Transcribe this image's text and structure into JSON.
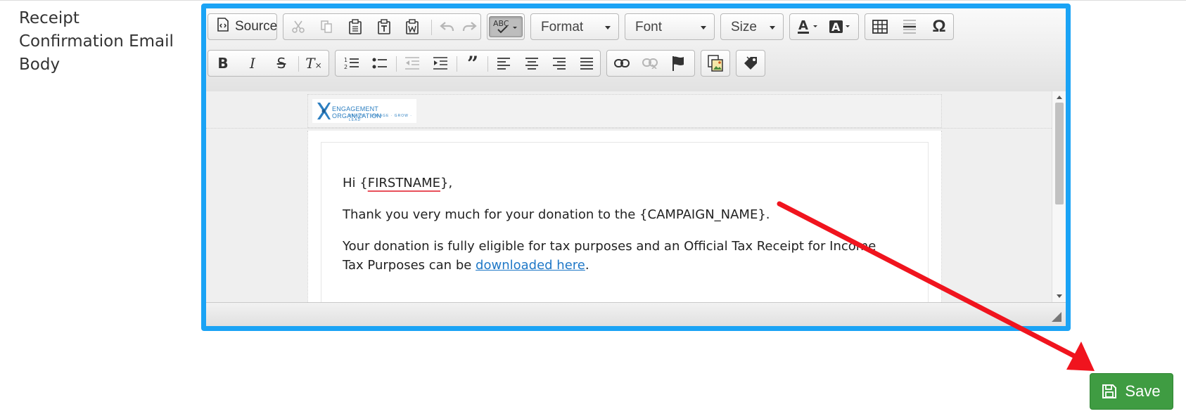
{
  "form": {
    "field_label": "Receipt Confirmation Email Body"
  },
  "toolbar": {
    "source_label": "Source",
    "format_label": "Format",
    "font_label": "Font",
    "size_label": "Size",
    "row1_icons": [
      "source-icon",
      "cut-icon",
      "copy-icon",
      "paste-icon",
      "paste-text-icon",
      "paste-from-word-icon",
      "undo-icon",
      "redo-icon",
      "spellcheck-icon",
      "text-color-icon",
      "background-color-icon",
      "table-icon",
      "horizontal-line-icon",
      "special-character-icon"
    ],
    "row2_icons": [
      "bold-icon",
      "italic-icon",
      "strikethrough-icon",
      "remove-format-icon",
      "numbered-list-icon",
      "bulleted-list-icon",
      "decrease-indent-icon",
      "increase-indent-icon",
      "blockquote-icon",
      "align-left-icon",
      "align-center-icon",
      "align-right-icon",
      "justify-icon",
      "link-icon",
      "unlink-icon",
      "anchor-icon",
      "image-icon",
      "placeholder-tag-icon"
    ]
  },
  "editor": {
    "logo_text": "ENGAGEMENT ORGANIZATION",
    "logo_tagline": "REACH · ENGAGE · GROW · LEAD",
    "greeting_prefix": "Hi {",
    "greeting_token": "FIRSTNAME",
    "greeting_suffix": "},",
    "para1": "Thank you very much for your donation to the {CAMPAIGN_NAME}.",
    "para2_text": "Your donation is fully eligible for tax purposes and an Official Tax Receipt for Income Tax Purposes can be ",
    "para2_link": "downloaded here",
    "para2_end": "."
  },
  "actions": {
    "save_label": "Save"
  },
  "colors": {
    "editor_border": "#1aa3f5",
    "save_button": "#3f9c42",
    "annotation_arrow": "#f0141e",
    "link": "#1f78c7"
  }
}
